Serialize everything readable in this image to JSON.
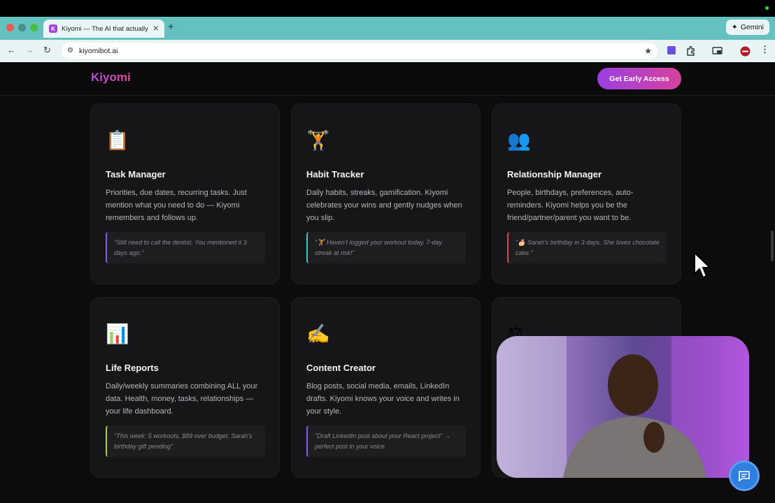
{
  "browser": {
    "tab_title": "Kiyomi — The AI that actually",
    "tab_favicon": "K",
    "new_tab": "+",
    "gemini_label": "Gemini",
    "url": "kiyomibot.ai"
  },
  "site": {
    "logo": "Kiyomi",
    "cta_label": "Get Early Access"
  },
  "cards": [
    {
      "icon": "📋",
      "title": "Task Manager",
      "desc": "Priorities, due dates, recurring tasks. Just mention what you need to do — Kiyomi remembers and follows up.",
      "quote": "\"Still need to call the dentist. You mentioned it 3 days ago.\"",
      "accent": "#8a5cf6"
    },
    {
      "icon": "🏋",
      "title": "Habit Tracker",
      "desc": "Daily habits, streaks, gamification. Kiyomi celebrates your wins and gently nudges when you slip.",
      "quote": "\"🏋 Haven't logged your workout today. 7-day streak at risk!\"",
      "accent": "#2fd0c0"
    },
    {
      "icon": "👥",
      "title": "Relationship Manager",
      "desc": "People, birthdays, preferences, auto-reminders. Kiyomi helps you be the friend/partner/parent you want to be.",
      "quote": "\"🎂 Sarah's birthday in 3 days. She loves chocolate cake.\"",
      "accent": "#e0405f"
    },
    {
      "icon": "📊",
      "title": "Life Reports",
      "desc": "Daily/weekly summaries combining ALL your data. Health, money, tasks, relationships — your life dashboard.",
      "quote": "\"This week: 5 workouts, $89 over budget, Sarah's birthday gift pending\"",
      "accent": "#a6d62c"
    },
    {
      "icon": "✍",
      "title": "Content Creator",
      "desc": "Blog posts, social media, emails, LinkedIn drafts. Kiyomi knows your voice and writes in your style.",
      "quote": "\"Draft LinkedIn post about your React project\" → perfect post in your voice",
      "accent": "#8a5cf6"
    },
    {
      "icon": "⚖",
      "title": "",
      "desc": "",
      "quote": "",
      "accent": "#8a5cf6"
    }
  ],
  "colors": {
    "chrome_bg": "#64c1bf",
    "page_bg": "#0c0c0d",
    "card_bg": "#161618",
    "brand_gradient_start": "#9a3fe0",
    "brand_gradient_end": "#d8419d",
    "chat_button": "#2f7fe0"
  },
  "icons": {
    "back": "back-arrow-icon",
    "forward": "forward-arrow-icon",
    "reload": "reload-icon",
    "star": "star-icon",
    "chat": "chat-bubble-icon",
    "cursor": "mouse-pointer-icon"
  }
}
